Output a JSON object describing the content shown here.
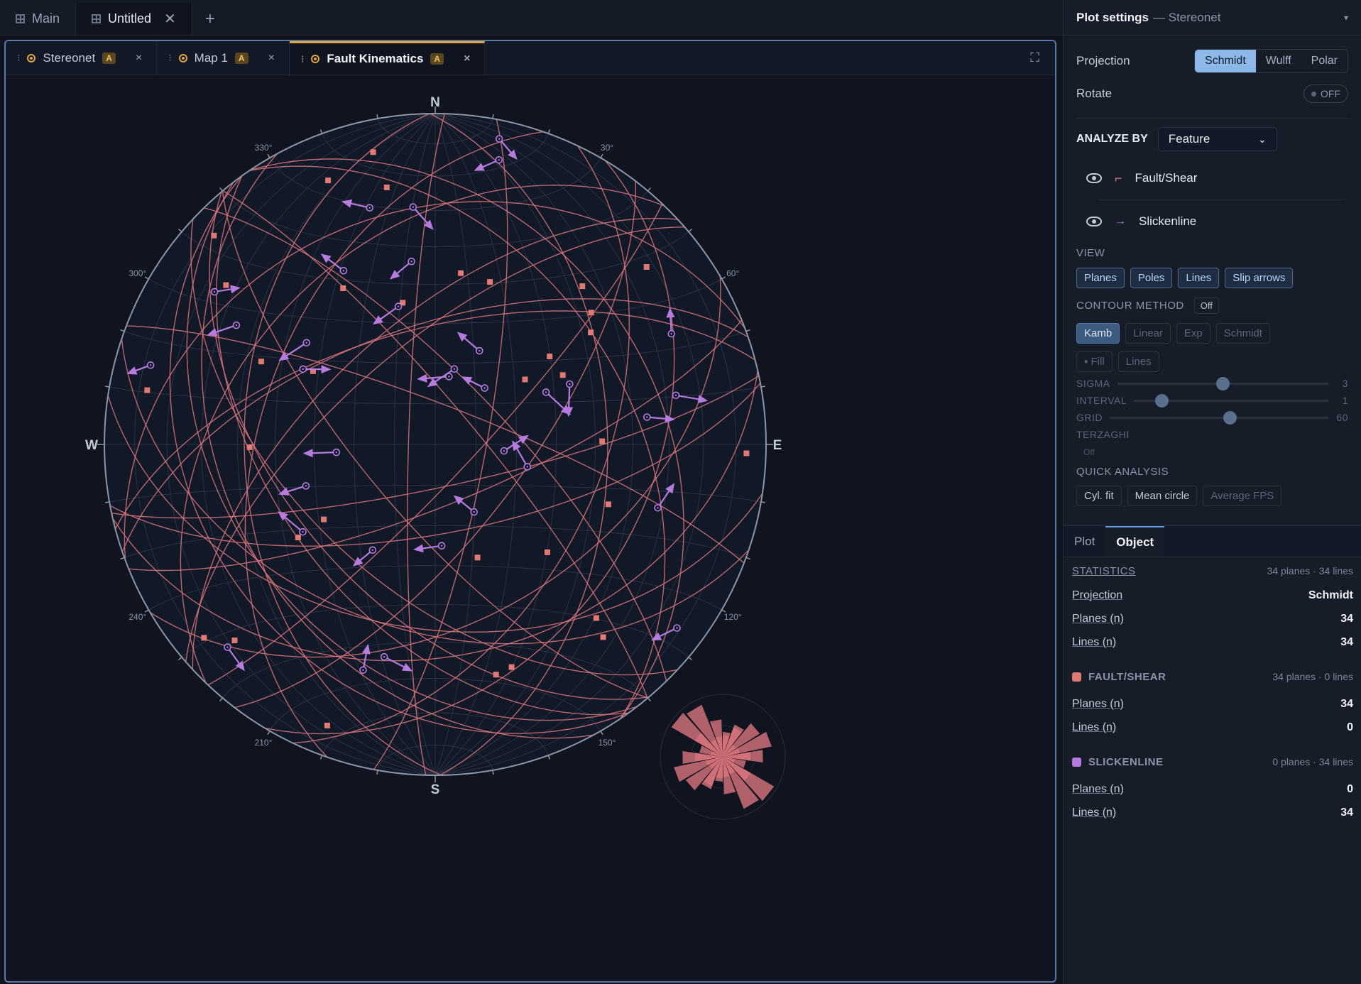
{
  "top_tabs": [
    {
      "label": "Main"
    },
    {
      "label": "Untitled"
    }
  ],
  "doc_tabs": [
    {
      "label": "Stereonet",
      "badge": "A"
    },
    {
      "label": "Map 1",
      "badge": "A"
    },
    {
      "label": "Fault Kinematics",
      "badge": "A"
    }
  ],
  "stereonet": {
    "north": "N",
    "south": "S",
    "east": "E",
    "west": "W",
    "degree_labels": [
      "30°",
      "60°",
      "120°",
      "150°",
      "210°",
      "240°",
      "300°",
      "330°"
    ],
    "plane_color": "#d9747c",
    "pole_color": "#e07a72",
    "line_color": "#b77be0",
    "plane_count": 34,
    "line_count": 34
  },
  "panel": {
    "title": "Plot settings",
    "subtitle": "— Stereonet",
    "projection_label": "Projection",
    "projection_options": [
      "Schmidt",
      "Wulff",
      "Polar"
    ],
    "projection_selected": "Schmidt",
    "rotate_label": "Rotate",
    "rotate_value": "OFF",
    "analyze_by_label": "ANALYZE BY",
    "analyze_by_value": "Feature",
    "layers": [
      {
        "name": "Fault/Shear",
        "color": "#e07a72",
        "icon": "fault-icon"
      },
      {
        "name": "Slickenline",
        "color": "#b77be0",
        "icon": "line-icon"
      }
    ],
    "view_label": "VIEW",
    "view_options": [
      "Planes",
      "Poles",
      "Lines",
      "Slip arrows"
    ],
    "contour_label": "CONTOUR METHOD",
    "contour_value": "Off",
    "contour_methods": [
      "Kamb",
      "Linear",
      "Exp",
      "Schmidt"
    ],
    "contour_render": [
      "Fill",
      "Lines"
    ],
    "sliders": [
      {
        "label": "SIGMA",
        "value": "3",
        "fraction": 0.5
      },
      {
        "label": "INTERVAL",
        "value": "1",
        "fraction": 0.14
      },
      {
        "label": "GRID",
        "value": "60",
        "fraction": 0.55
      }
    ],
    "terzaghi_label": "TERZAGHI",
    "terzaghi_value": "Off",
    "quick_label": "QUICK ANALYSIS",
    "quick_buttons": [
      "Cyl. fit",
      "Mean circle",
      "Average FPS"
    ],
    "sub_tabs": [
      "Plot",
      "Object"
    ],
    "statistics": {
      "title": "STATISTICS",
      "summary": "34 planes · 34 lines",
      "rows": [
        {
          "k": "Projection",
          "v": "Schmidt"
        },
        {
          "k": "Planes (n)",
          "v": "34"
        },
        {
          "k": "Lines (n)",
          "v": "34"
        }
      ]
    },
    "groups": [
      {
        "title": "FAULT/SHEAR",
        "color": "#e07a72",
        "summary": "34 planes · 0 lines",
        "rows": [
          {
            "k": "Planes (n)",
            "v": "34"
          },
          {
            "k": "Lines (n)",
            "v": "0"
          }
        ]
      },
      {
        "title": "SLICKENLINE",
        "color": "#b77be0",
        "summary": "0 planes · 34 lines",
        "rows": [
          {
            "k": "Planes (n)",
            "v": "0"
          },
          {
            "k": "Lines (n)",
            "v": "34"
          }
        ]
      }
    ]
  }
}
